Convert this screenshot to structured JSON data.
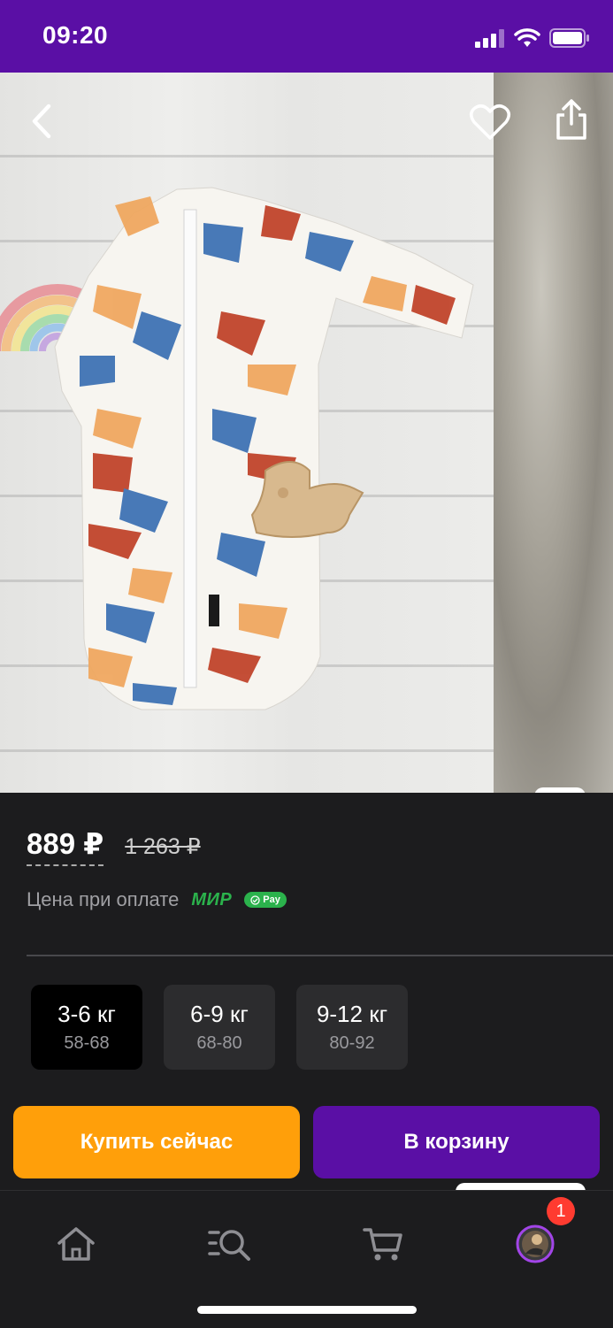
{
  "status_bar": {
    "time": "09:20",
    "icons": [
      "signal-icon",
      "wifi-icon",
      "battery-icon"
    ]
  },
  "gallery": {
    "icons": [
      "back-icon",
      "heart-icon",
      "share-icon",
      "image-search-icon"
    ]
  },
  "price": {
    "current": "889 ₽",
    "old": "1 263 ₽",
    "payment_note": "Цена при оплате",
    "mir_label": "МИР",
    "pay_badge": "Pay"
  },
  "sizes": [
    {
      "label": "3-6 кг",
      "sub": "58-68",
      "selected": true
    },
    {
      "label": "6-9 кг",
      "sub": "68-80",
      "selected": false
    },
    {
      "label": "9-12 кг",
      "sub": "80-92",
      "selected": false
    }
  ],
  "actions": {
    "buy_now": "Купить сейчас",
    "add_to_cart": "В корзину"
  },
  "bottom_nav": {
    "items": [
      "home-icon",
      "catalog-search-icon",
      "cart-icon",
      "profile-avatar"
    ],
    "profile_badge": "1"
  },
  "colors": {
    "brand": "#5a0fa5",
    "buy": "#ff9f0a",
    "background": "#1c1c1e",
    "mir": "#2bb24c",
    "badge": "#ff3b30"
  }
}
